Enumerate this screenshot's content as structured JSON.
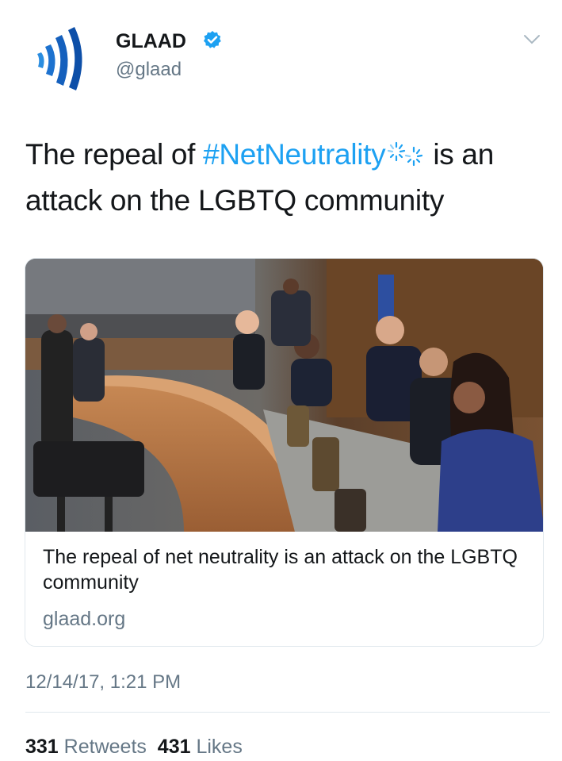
{
  "author": {
    "name": "GLAAD",
    "handle": "@glaad",
    "verified": true,
    "logo_icon": "glaad-logo-icon"
  },
  "tweet": {
    "text_before": "The repeal of ",
    "hashtag": "#NetNeutrality",
    "hashflag_icon": "loading-spinner-hashflag-icon",
    "text_after": " is an attack on the LGBTQ community"
  },
  "card": {
    "image_description_icon": "fcc-hearing-photo",
    "title": "The repeal of net neutrality is an attack on the LGBTQ community",
    "domain": "glaad.org"
  },
  "timestamp": "12/14/17, 1:21 PM",
  "stats": {
    "retweets_count": "331",
    "retweets_label": "Retweets",
    "likes_count": "431",
    "likes_label": "Likes"
  },
  "colors": {
    "accent": "#1da1f2",
    "brand_logo": "#1560bd",
    "secondary_text": "#657786"
  }
}
